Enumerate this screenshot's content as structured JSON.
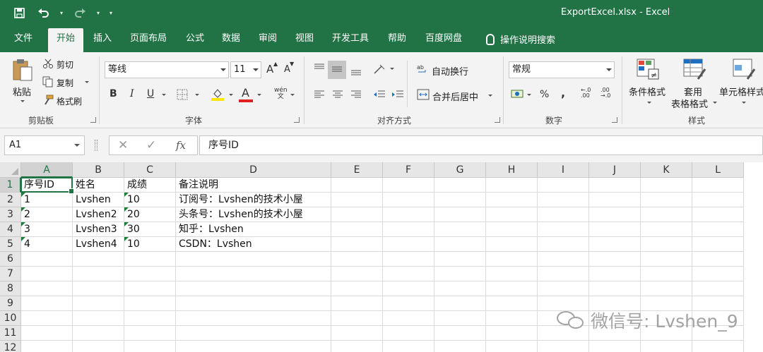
{
  "window": {
    "title": "ExportExcel.xlsx  -  Excel"
  },
  "qat": {
    "save": "💾",
    "undo": "↶",
    "redo": "↷"
  },
  "tabs": [
    {
      "label": "文件"
    },
    {
      "label": "开始"
    },
    {
      "label": "插入"
    },
    {
      "label": "页面布局"
    },
    {
      "label": "公式"
    },
    {
      "label": "数据"
    },
    {
      "label": "审阅"
    },
    {
      "label": "视图"
    },
    {
      "label": "开发工具"
    },
    {
      "label": "帮助"
    },
    {
      "label": "百度网盘"
    }
  ],
  "active_tab": "开始",
  "tell_me": "操作说明搜索",
  "ribbon": {
    "clipboard": {
      "paste": "粘贴",
      "cut": "剪切",
      "copy": "复制",
      "format_painter": "格式刷",
      "label": "剪贴板"
    },
    "font": {
      "name": "等线",
      "size": "11",
      "grow": "A",
      "shrink": "A",
      "bold": "B",
      "italic": "I",
      "underline": "U",
      "label": "字体",
      "font_color_glyph": "A",
      "phonetic": "wén\n文"
    },
    "alignment": {
      "wrap_text": "自动换行",
      "merge_center": "合并后居中",
      "label": "对齐方式"
    },
    "number": {
      "format": "常规",
      "percent": "%",
      "comma": ",",
      "label": "数字"
    },
    "styles": {
      "conditional": "条件格式",
      "table_format_1": "套用",
      "table_format_2": "表格格式",
      "cell_styles": "单元格样式",
      "label": "样式"
    }
  },
  "formula_bar": {
    "name_box": "A1",
    "fx": "fx",
    "cancel": "✕",
    "enter": "✓",
    "content": "序号ID"
  },
  "sheet": {
    "columns": [
      "A",
      "B",
      "C",
      "D",
      "E",
      "F",
      "G",
      "H",
      "I",
      "J",
      "K",
      "L"
    ],
    "rows": [
      "1",
      "2",
      "3",
      "4",
      "5",
      "6",
      "7",
      "8",
      "9",
      "10",
      "11",
      "12"
    ],
    "selected_cell": "A1",
    "cells": [
      [
        "序号ID",
        "姓名",
        "成绩",
        "备注说明"
      ],
      [
        "1",
        "Lvshen",
        "10",
        "订阅号：Lvshen的技术小屋"
      ],
      [
        "2",
        "Lvshen2",
        "20",
        "头条号：Lvshen的技术小屋"
      ],
      [
        "3",
        "Lvshen3",
        "30",
        "知乎：Lvshen"
      ],
      [
        "4",
        "Lvshen4",
        "10",
        "CSDN：Lvshen"
      ]
    ]
  },
  "watermark": "微信号: Lvshen_9"
}
